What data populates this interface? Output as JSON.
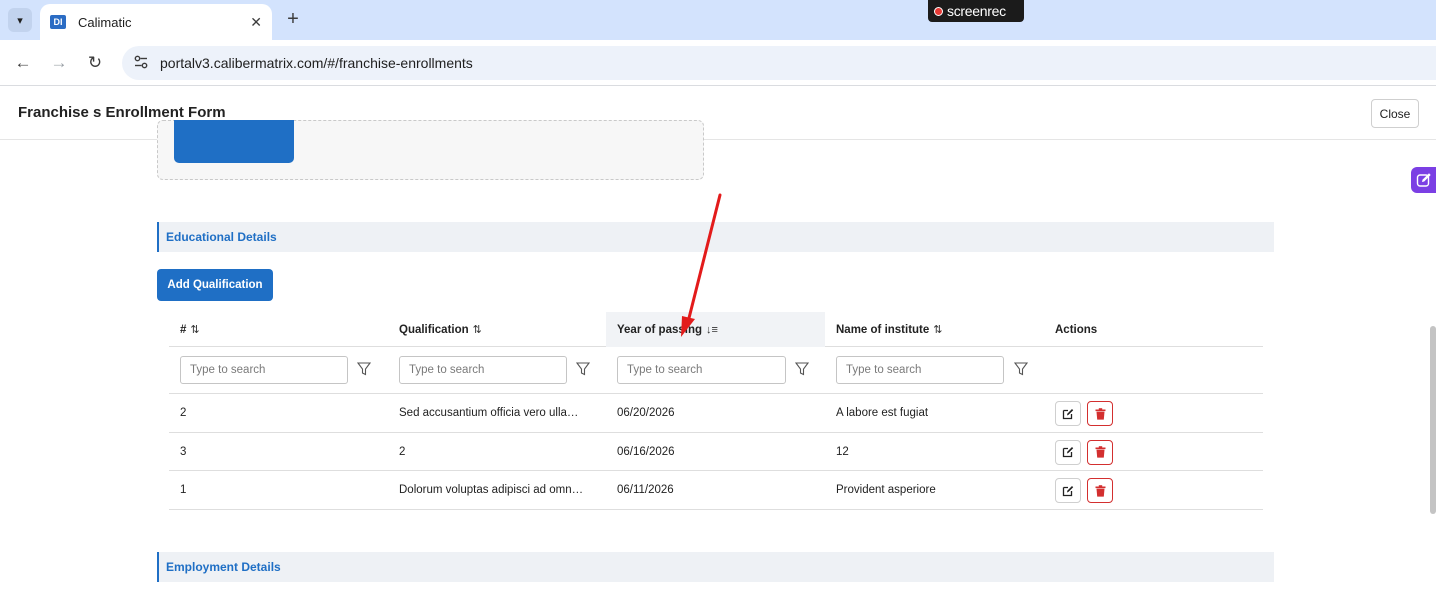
{
  "browser": {
    "tab_title": "Calimatic",
    "tab_favicon_text": "DI",
    "url": "portalv3.calibermatrix.com/#/franchise-enrollments",
    "recorder_label": "screenrec",
    "accent_color": "#d3e3fd"
  },
  "modal": {
    "title": "Franchise s Enrollment Form",
    "close_label": "Close"
  },
  "educational": {
    "section_title": "Educational Details",
    "add_button_label": "Add Qualification",
    "columns": [
      {
        "label": "#",
        "sort_icon": "sort-both-icon"
      },
      {
        "label": "Qualification",
        "sort_icon": "sort-both-icon"
      },
      {
        "label": "Year of passing",
        "sort_icon": "sort-desc-icon",
        "sorted": true
      },
      {
        "label": "Name of institute",
        "sort_icon": "sort-both-icon"
      },
      {
        "label": "Actions"
      }
    ],
    "filter_placeholder": "Type to search",
    "rows": [
      {
        "num": "2",
        "qualification": "Sed accusantium officia vero ulla…",
        "year": "06/20/2026",
        "institute": "A labore est fugiat"
      },
      {
        "num": "3",
        "qualification": "2",
        "year": "06/16/2026",
        "institute": "12"
      },
      {
        "num": "1",
        "qualification": "Dolorum voluptas adipisci ad omn…",
        "year": "06/11/2026",
        "institute": "Provident asperiore"
      }
    ]
  },
  "employment": {
    "section_title": "Employment Details"
  },
  "colors": {
    "primary": "#1f6fc5",
    "danger": "#d32f2f",
    "annotation_arrow": "#e31b1b"
  }
}
